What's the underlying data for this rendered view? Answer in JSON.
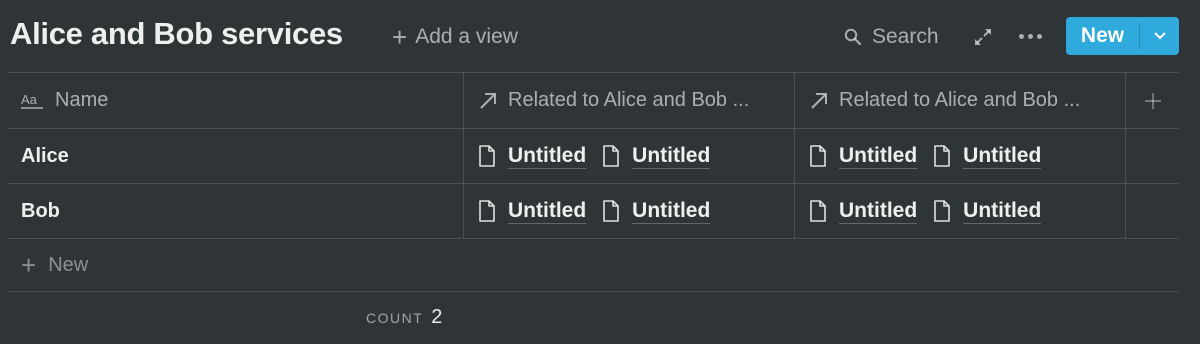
{
  "page": {
    "title": "Alice and Bob services",
    "add_view_label": "Add a view"
  },
  "toolbar": {
    "search_label": "Search",
    "new_label": "New"
  },
  "table": {
    "columns": [
      {
        "label": "Name",
        "icon": "text-property-icon"
      },
      {
        "label": "Related to Alice and Bob ...",
        "icon": "relation-arrow-icon"
      },
      {
        "label": "Related to Alice and Bob ...",
        "icon": "relation-arrow-icon"
      }
    ],
    "rows": [
      {
        "name": "Alice",
        "rel1": [
          "Untitled",
          "Untitled"
        ],
        "rel2": [
          "Untitled",
          "Untitled"
        ]
      },
      {
        "name": "Bob",
        "rel1": [
          "Untitled",
          "Untitled"
        ],
        "rel2": [
          "Untitled",
          "Untitled"
        ]
      }
    ],
    "new_row_label": "New"
  },
  "footer": {
    "count_label": "COUNT",
    "count_value": "2"
  },
  "colors": {
    "background": "#2f3437",
    "accent": "#2eaadc"
  }
}
